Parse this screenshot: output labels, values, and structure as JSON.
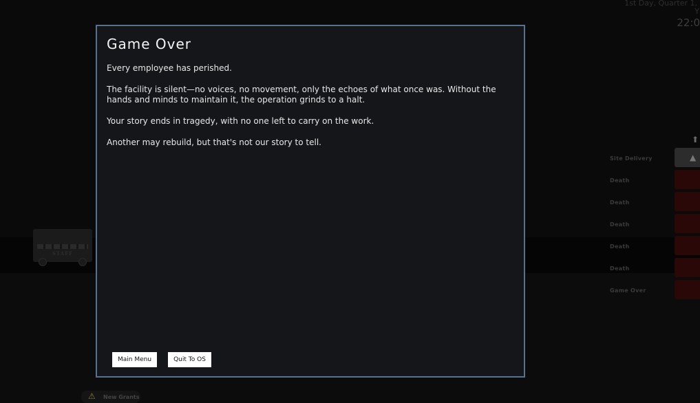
{
  "hud": {
    "date": "1st Day, Quarter 1,",
    "date_suffix": "Y",
    "time": "22:0"
  },
  "bus": {
    "label": "STAFF"
  },
  "events": [
    {
      "label": "Site Delivery",
      "type": "delivery",
      "icon": "delivery-icon"
    },
    {
      "label": "Death",
      "type": "death"
    },
    {
      "label": "Death",
      "type": "death"
    },
    {
      "label": "Death",
      "type": "death"
    },
    {
      "label": "Death",
      "type": "death"
    },
    {
      "label": "Death",
      "type": "death"
    },
    {
      "label": "Game Over",
      "type": "game-over"
    }
  ],
  "colors": {
    "death_box": "#2a0808",
    "modal_border": "#55728f",
    "modal_bg": "#14161a"
  },
  "bottom": {
    "grants_label": "New Grants",
    "icon": "warning-icon"
  },
  "modal": {
    "title": "Game Over",
    "paragraphs": [
      "Every employee has perished.",
      "The facility is silent—no voices, no movement, only the echoes of what once was. Without the hands and minds to maintain it, the operation grinds to a halt.",
      "Your story ends in tragedy, with no one left to carry on the work.",
      "Another may rebuild, but that's not our story to tell."
    ],
    "buttons": {
      "main_menu": "Main Menu",
      "quit": "Quit To OS"
    }
  }
}
